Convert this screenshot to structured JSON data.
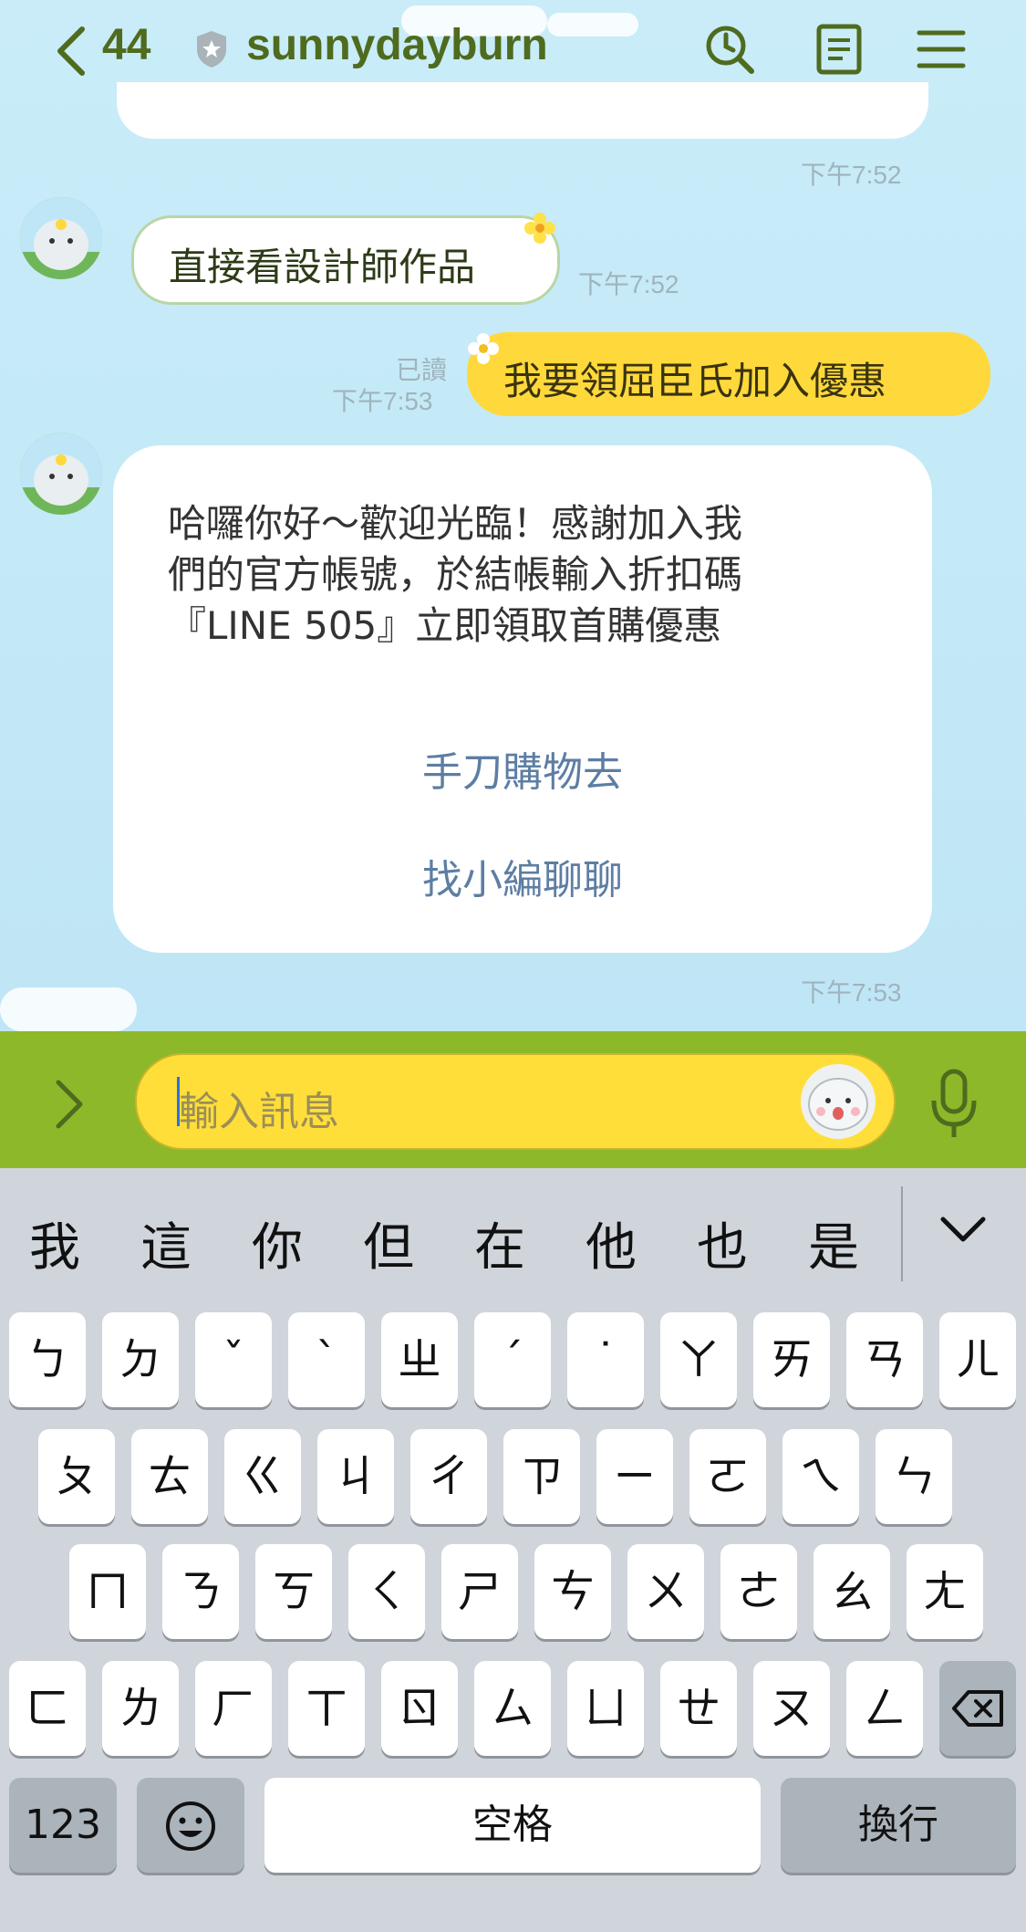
{
  "header": {
    "back_count": "44",
    "title": "sunnydayburn",
    "icons": [
      "back-chevron-icon",
      "shield-badge-icon",
      "search-icon",
      "note-icon",
      "menu-icon"
    ]
  },
  "messages": {
    "stub_time": "下午7:52",
    "m1": {
      "text": "直接看設計師作品",
      "time": "下午7:52"
    },
    "m2": {
      "read": "已讀",
      "time": "下午7:53",
      "text": "我要領屈臣氏加入優惠"
    },
    "card": {
      "line1": "哈囉你好～歡迎光臨！感謝加入我",
      "line2": "們的官方帳號，於結帳輸入折扣碼",
      "line3": "『LINE 505』立即領取首購優惠",
      "link1": "手刀購物去",
      "link2": "找小編聊聊",
      "time": "下午7:53"
    }
  },
  "input": {
    "placeholder": "輸入訊息"
  },
  "keyboard": {
    "candidates": [
      "我",
      "這",
      "你",
      "但",
      "在",
      "他",
      "也",
      "是"
    ],
    "row1": [
      "ㄅ",
      "ㄉ",
      "ˇ",
      "ˋ",
      "ㄓ",
      "ˊ",
      "˙",
      "ㄚ",
      "ㄞ",
      "ㄢ",
      "ㄦ"
    ],
    "row2": [
      "ㄆ",
      "ㄊ",
      "ㄍ",
      "ㄐ",
      "ㄔ",
      "ㄗ",
      "ㄧ",
      "ㄛ",
      "ㄟ",
      "ㄣ"
    ],
    "row3": [
      "ㄇ",
      "ㄋ",
      "ㄎ",
      "ㄑ",
      "ㄕ",
      "ㄘ",
      "ㄨ",
      "ㄜ",
      "ㄠ",
      "ㄤ"
    ],
    "row4": [
      "ㄈ",
      "ㄌ",
      "ㄏ",
      "ㄒ",
      "ㄖ",
      "ㄙ",
      "ㄩ",
      "ㄝ",
      "ㄡ",
      "ㄥ"
    ],
    "numbers_label": "123",
    "space_label": "空格",
    "return_label": "換行"
  },
  "colors": {
    "header_green": "#4f6b1e",
    "input_bar": "#8db829",
    "out_bubble": "#ffd93b",
    "link": "#5d7ea3"
  }
}
